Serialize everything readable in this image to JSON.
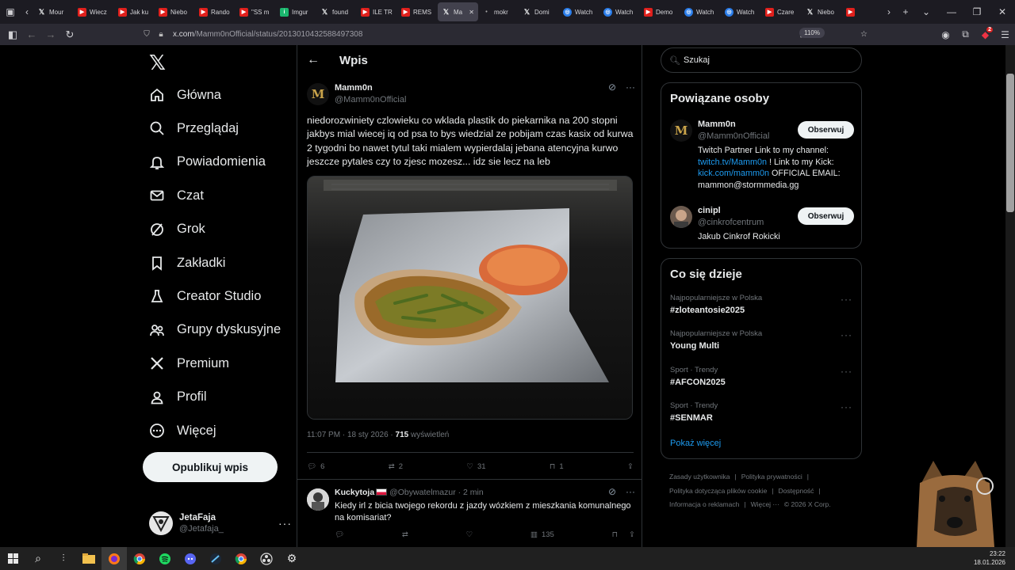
{
  "browser": {
    "tabs": [
      {
        "title": "Mour",
        "icon": "x-favicon"
      },
      {
        "title": "Wiecz",
        "icon": "youtube-favicon"
      },
      {
        "title": "Jak ku",
        "icon": "youtube-favicon"
      },
      {
        "title": "Niebo",
        "icon": "youtube-favicon"
      },
      {
        "title": "Rando",
        "icon": "youtube-favicon"
      },
      {
        "title": "\"SS m",
        "icon": "youtube-favicon"
      },
      {
        "title": "Imgur",
        "icon": "imgur-favicon"
      },
      {
        "title": "found",
        "icon": "x-favicon"
      },
      {
        "title": "ILE TR",
        "icon": "youtube-favicon"
      },
      {
        "title": "REMS",
        "icon": "youtube-favicon"
      },
      {
        "title": "Ma",
        "icon": "x-favicon",
        "active": true
      },
      {
        "title": "mokr",
        "icon": "dot-favicon"
      },
      {
        "title": "Domi",
        "icon": "x-favicon"
      },
      {
        "title": "Watch",
        "icon": "watch-favicon"
      },
      {
        "title": "Watch",
        "icon": "watch-favicon"
      },
      {
        "title": "Demo",
        "icon": "youtube-favicon"
      },
      {
        "title": "Watch",
        "icon": "watch-favicon"
      },
      {
        "title": "Watch",
        "icon": "watch-favicon"
      },
      {
        "title": "Czare",
        "icon": "youtube-favicon"
      },
      {
        "title": "Niebo",
        "icon": "x-favicon"
      },
      {
        "title": "",
        "icon": "youtube-favicon"
      }
    ],
    "url_host": "x.com",
    "url_path": "/Mamm0nOfficial/status/2013010432588497308",
    "zoom": "110%",
    "extension_badge": "2"
  },
  "leftnav": {
    "items": [
      {
        "label": "Główna",
        "icon": "home-icon"
      },
      {
        "label": "Przeglądaj",
        "icon": "search-icon"
      },
      {
        "label": "Powiadomienia",
        "icon": "bell-icon"
      },
      {
        "label": "Czat",
        "icon": "mail-icon"
      },
      {
        "label": "Grok",
        "icon": "grok-icon"
      },
      {
        "label": "Zakładki",
        "icon": "bookmark-icon"
      },
      {
        "label": "Creator Studio",
        "icon": "creator-studio-icon"
      },
      {
        "label": "Grupy dyskusyjne",
        "icon": "communities-icon"
      },
      {
        "label": "Premium",
        "icon": "x-premium-icon"
      },
      {
        "label": "Profil",
        "icon": "profile-icon"
      },
      {
        "label": "Więcej",
        "icon": "more-circle-icon"
      }
    ],
    "post_button": "Opublikuj wpis",
    "account": {
      "name": "JetaFaja",
      "handle": "@Jetafaja_"
    }
  },
  "main": {
    "header_title": "Wpis",
    "tweet": {
      "author_name": "Mamm0n",
      "author_handle": "@Mamm0nOfficial",
      "text": "niedorozwiniety czlowieku co wklada plastik do piekarnika na 200 stopni jakbys mial wiecej iq od psa to bys wiedzial ze pobijam czas kasix od kurwa 2 tygodni bo nawet tytul taki mialem wypierdalaj jebana atencyjna kurwo jeszcze pytales czy to zjesc mozesz... idz sie lecz na leb",
      "time": "11:07 PM · 18 sty 2026 · ",
      "views_count": "715",
      "views_label": " wyświetleń",
      "replies": "6",
      "reposts": "2",
      "likes": "31",
      "bookmarks": "1"
    },
    "reply": {
      "author_name": "Kuckytoja",
      "author_handle": "@Obywatelmazur",
      "time": "· 2 min",
      "text": "Kiedy irl z bicia twojego rekordu z jazdy wózkiem z mieszkania komunalnego na komisariat?",
      "views": "135"
    }
  },
  "right": {
    "search_placeholder": "Szukaj",
    "related_title": "Powiązane osoby",
    "people": [
      {
        "name": "Mamm0n",
        "handle": "@Mamm0nOfficial",
        "bio_a": "Twitch Partner Link to my channel: ",
        "bio_link1": "twitch.tv/Mamm0n",
        "bio_b": " ! Link to my Kick: ",
        "bio_link2": "kick.com/mamm0n",
        "bio_c": " OFFICIAL EMAIL: mammon@stormmedia.gg",
        "follow": "Obserwuj"
      },
      {
        "name": "cinipl",
        "handle": "@cinkrofcentrum",
        "bio_a": "Jakub Cinkrof Rokicki",
        "follow": "Obserwuj"
      }
    ],
    "trends_title": "Co się dzieje",
    "trends": [
      {
        "context": "Najpopularniejsze w Polska",
        "name": "#zloteantosie2025"
      },
      {
        "context": "Najpopularniejsze w Polska",
        "name": "Young Multi"
      },
      {
        "context": "Sport · Trendy",
        "name": "#AFCON2025"
      },
      {
        "context": "Sport · Trendy",
        "name": "#SENMAR"
      }
    ],
    "show_more": "Pokaż więcej",
    "footer": [
      "Zasady użytkownika",
      "|",
      "Polityka prywatności",
      "|",
      "Polityka dotycząca plików cookie",
      "|",
      "Dostępność",
      "|",
      "Informacja o reklamach",
      "|",
      "Więcej ···",
      "© 2026 X Corp."
    ]
  },
  "taskbar": {
    "time": "23:22",
    "date": "18.01.2026"
  },
  "colors": {
    "accent": "#1d9bf0",
    "background": "#000000",
    "border": "#2f3336",
    "secondary_text": "#71767b"
  }
}
